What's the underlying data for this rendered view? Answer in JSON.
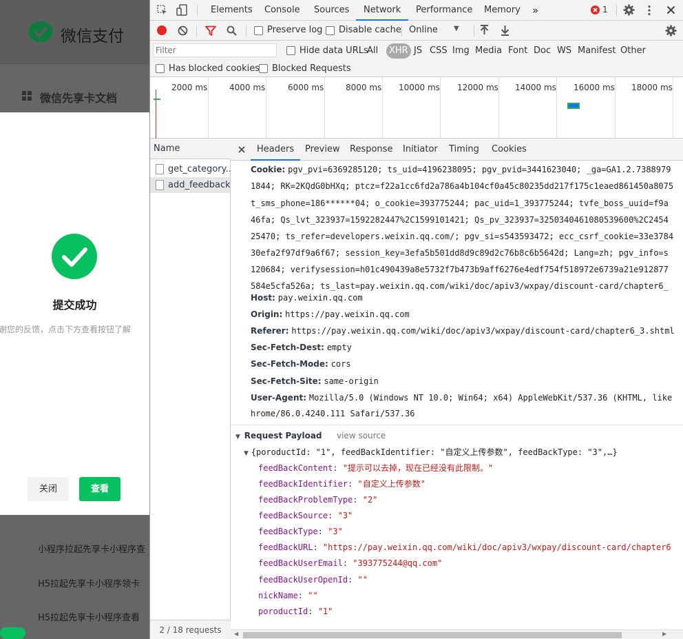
{
  "page": {
    "brand": "微信支付",
    "doc_title": "微信先享卡文档",
    "links": [
      "小程序拉起先享卡小程序查",
      "H5拉起先享卡小程序领卡",
      "H5拉起先享卡小程序查看"
    ],
    "modal": {
      "title": "提交成功",
      "desc": "谢您的反馈，点击下方查看按钮了解",
      "close_label": "关闭",
      "view_label": "查看"
    }
  },
  "devtools": {
    "tabs": [
      "Elements",
      "Console",
      "Sources",
      "Network",
      "Performance",
      "Memory",
      "»"
    ],
    "active_tab": "Network",
    "error_count": "1",
    "toolbar": {
      "preserve_log": "Preserve log",
      "disable_cache": "Disable cache",
      "throttle": "Online"
    },
    "filter": {
      "placeholder": "Filter",
      "hide_data_urls": "Hide data URLs",
      "types": [
        "All",
        "XHR",
        "JS",
        "CSS",
        "Img",
        "Media",
        "Font",
        "Doc",
        "WS",
        "Manifest",
        "Other"
      ],
      "active_type": "XHR",
      "has_blocked_cookies": "Has blocked cookies",
      "blocked_requests": "Blocked Requests"
    },
    "timeline_ticks": [
      "2000 ms",
      "4000 ms",
      "6000 ms",
      "8000 ms",
      "10000 ms",
      "12000 ms",
      "14000 ms",
      "16000 ms",
      "18000 ms"
    ],
    "name_header": "Name",
    "requests": [
      "get_category...",
      "add_feedback"
    ],
    "requests_footer": "2 / 18 requests",
    "detail_tabs": [
      "Headers",
      "Preview",
      "Response",
      "Initiator",
      "Timing",
      "Cookies"
    ],
    "active_detail_tab": "Headers",
    "cookie_label": "Cookie:",
    "cookie_lines": [
      "pgv_pvi=6369285120; ts_uid=4196238095; pgv_pvid=3441623040; _ga=GA1.2.7388979",
      "1844; RK=2KQdG0bHXq; ptcz=f22a1cc6fd2a786a4b104cf0a45c80235dd217f175c1eaed861450a8075",
      "t_sms_phone=186******04; o_cookie=393775244; pac_uid=1_393775244; tvfe_boss_uuid=f9a",
      "46fa; Qs_lvt_323937=1592282447%2C1599101421; Qs_pv_323937=3250340461080539600%2C2454",
      "25470; ts_refer=developers.weixin.qq.com/; pgv_si=s543593472; ecc_csrf_cookie=33e3784",
      "30efa2f97df9a6f67; session_key=3efa5b501dd8d9c89d2c76b8c6b5642d; Lang=zh; pgv_info=s",
      "120684; verifysession=h01c490439a8e5732f7b473b9aff6276e4edf754f518972e6739a21e912877",
      "584e5cfa526a; ts_last=pay.weixin.qq.com/wiki/doc/apiv3/wxpay/discount-card/chapter6_"
    ],
    "headers": [
      {
        "name": "Host:",
        "value": "pay.weixin.qq.com"
      },
      {
        "name": "Origin:",
        "value": "https://pay.weixin.qq.com"
      },
      {
        "name": "Referer:",
        "value": "https://pay.weixin.qq.com/wiki/doc/apiv3/wxpay/discount-card/chapter6_3.shtml"
      },
      {
        "name": "Sec-Fetch-Dest:",
        "value": "empty"
      },
      {
        "name": "Sec-Fetch-Mode:",
        "value": "cors"
      },
      {
        "name": "Sec-Fetch-Site:",
        "value": "same-origin"
      },
      {
        "name": "User-Agent:",
        "value": "Mozilla/5.0 (Windows NT 10.0; Win64; x64) AppleWebKit/537.36 (KHTML, like"
      }
    ],
    "ua_continuation": "hrome/86.0.4240.111 Safari/537.36",
    "payload_title": "Request Payload",
    "view_source": "view source",
    "payload_summary": "{poroductId: \"1\", feedBackIdentifier: \"自定义上传参数\", feedBackType: \"3\",…}",
    "payload": [
      {
        "key": "feedBackContent",
        "value": "\"提示可以去掉，现在已经没有此限制。\""
      },
      {
        "key": "feedBackIdentifier",
        "value": "\"自定义上传参数\""
      },
      {
        "key": "feedBackProblemType",
        "value": "\"2\""
      },
      {
        "key": "feedBackSource",
        "value": "\"3\""
      },
      {
        "key": "feedBackType",
        "value": "\"3\""
      },
      {
        "key": "feedBackURL",
        "value": "\"https://pay.weixin.qq.com/wiki/doc/apiv3/wxpay/discount-card/chapter6"
      },
      {
        "key": "feedBackUserEmail",
        "value": "\"393775244@qq.com\""
      },
      {
        "key": "feedBackUserOpenId",
        "value": "\"\""
      },
      {
        "key": "nickName",
        "value": "\"\""
      },
      {
        "key": "poroductId",
        "value": "\"1\""
      }
    ]
  },
  "colors": {
    "accent": "#1a73e8",
    "wechat_green": "#07c160",
    "record_red": "#e52424",
    "key_purple": "#881391",
    "string_red": "#c41a16"
  }
}
